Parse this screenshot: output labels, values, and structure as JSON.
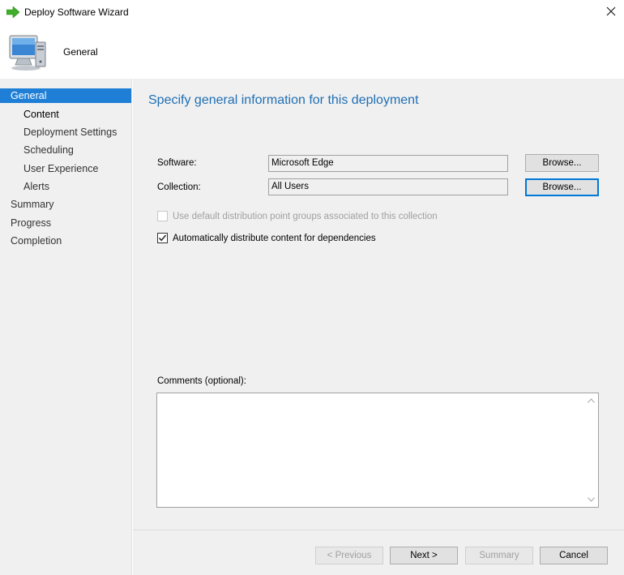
{
  "window": {
    "title": "Deploy Software Wizard",
    "header_title": "General",
    "icons": {
      "title": "green-arrow-icon",
      "header": "computer-icon",
      "close": "close-icon"
    }
  },
  "sidebar": {
    "items": [
      {
        "label": "General",
        "level": 0,
        "state": "active"
      },
      {
        "label": "Content",
        "level": 1,
        "state": "current"
      },
      {
        "label": "Deployment Settings",
        "level": 1,
        "state": "normal"
      },
      {
        "label": "Scheduling",
        "level": 1,
        "state": "normal"
      },
      {
        "label": "User Experience",
        "level": 1,
        "state": "normal"
      },
      {
        "label": "Alerts",
        "level": 1,
        "state": "normal"
      },
      {
        "label": "Summary",
        "level": 0,
        "state": "normal"
      },
      {
        "label": "Progress",
        "level": 0,
        "state": "normal"
      },
      {
        "label": "Completion",
        "level": 0,
        "state": "normal"
      }
    ]
  },
  "main": {
    "heading": "Specify general information for this deployment",
    "software": {
      "label": "Software:",
      "value": "Microsoft Edge",
      "browse_label": "Browse..."
    },
    "collection": {
      "label": "Collection:",
      "value": "All Users",
      "browse_label": "Browse..."
    },
    "checkbox_default_dp": {
      "label": "Use default distribution point groups associated to this collection",
      "checked": false,
      "enabled": false
    },
    "checkbox_auto_distribute": {
      "label": "Automatically distribute content for dependencies",
      "checked": true,
      "enabled": true
    },
    "comments": {
      "label": "Comments (optional):",
      "value": ""
    }
  },
  "footer": {
    "previous_label": "< Previous",
    "next_label": "Next >",
    "summary_label": "Summary",
    "cancel_label": "Cancel"
  },
  "colors": {
    "accent": "#1f7fd6",
    "heading": "#1f6fb4",
    "panel": "#f0f0f0"
  }
}
